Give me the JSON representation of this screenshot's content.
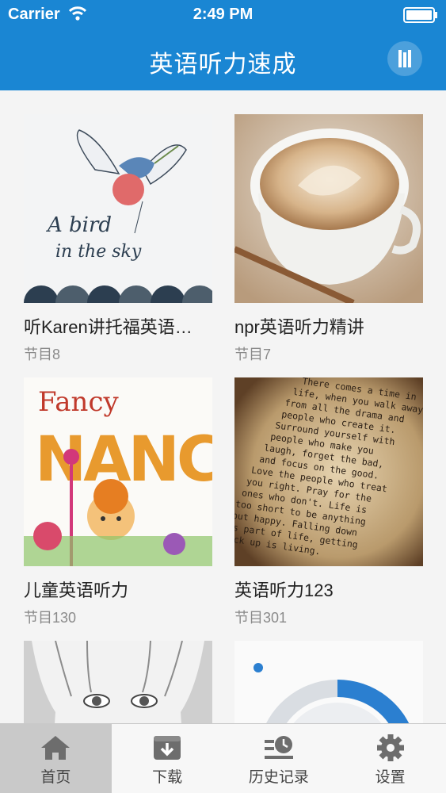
{
  "status_bar": {
    "carrier": "Carrier",
    "time": "2:49 PM"
  },
  "nav": {
    "title": "英语听力速成",
    "player_icon": "audio-bars-icon"
  },
  "albums": [
    {
      "title": "听Karen讲托福英语…",
      "count": "节目8",
      "cover": "bird-in-the-sky-illustration",
      "cover_text": [
        "A bird",
        "in the sky"
      ]
    },
    {
      "title": "npr英语听力精讲",
      "count": "节目7",
      "cover": "coffee-cup-photo"
    },
    {
      "title": "儿童英语听力",
      "count": "节目130",
      "cover": "fancy-nancy-book-cover",
      "cover_text": [
        "Fancy",
        "NANCY"
      ]
    },
    {
      "title": "英语听力123",
      "count": "节目301",
      "cover": "typewritten-quote-paper",
      "cover_text": [
        "There comes a time in",
        "life, when you walk away",
        "from all the drama and",
        "people who create it.",
        "Surround yourself with",
        "people who make you",
        "laugh, forget the bad,",
        "and focus on the good.",
        "Love the people who treat",
        "you right. Pray for the",
        "ones who don't. Life is",
        "too short to be anything",
        "but happy. Falling down",
        "is part of life, getting",
        "back up is living."
      ]
    },
    {
      "title": "",
      "count": "",
      "cover": "child-face-photo"
    },
    {
      "title": "",
      "count": "",
      "cover": "circular-progress-graphic"
    }
  ],
  "tabs": [
    {
      "label": "首页",
      "icon": "home-icon",
      "active": true
    },
    {
      "label": "下载",
      "icon": "download-icon",
      "active": false
    },
    {
      "label": "历史记录",
      "icon": "history-icon",
      "active": false
    },
    {
      "label": "设置",
      "icon": "gear-icon",
      "active": false
    }
  ],
  "colors": {
    "brand": "#1a86d3",
    "tab_active_bg": "#c9c9c9"
  }
}
